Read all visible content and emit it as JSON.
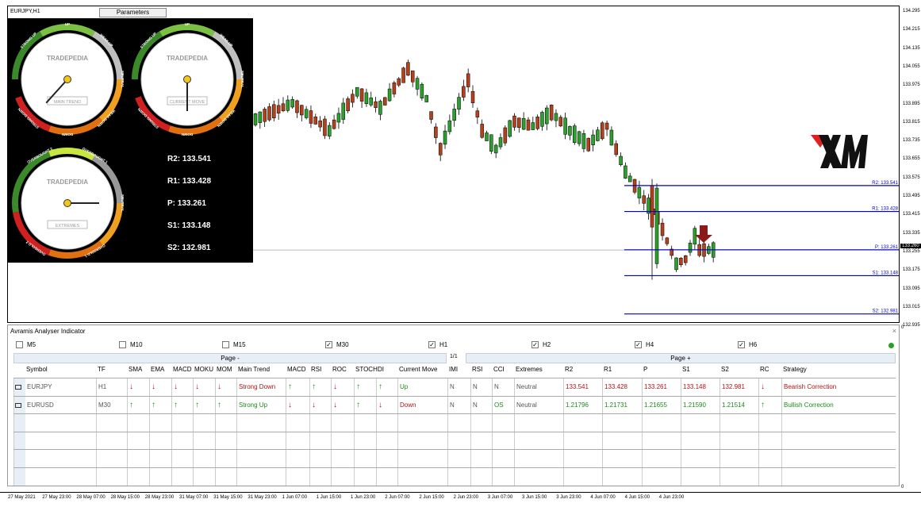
{
  "chart": {
    "symbol": "EURJPY,H1",
    "params_label": "Parameters",
    "price_ticks": [
      "134.295",
      "134.215",
      "134.135",
      "134.055",
      "133.975",
      "133.895",
      "133.815",
      "133.735",
      "133.655",
      "133.575",
      "133.495",
      "133.415",
      "133.335",
      "133.255",
      "133.175",
      "133.095",
      "133.015",
      "132.935"
    ],
    "current_price": "133.260",
    "zero_label": "0",
    "levels": [
      {
        "name": "R2",
        "label": "R2: 133.541",
        "value": 133.541
      },
      {
        "name": "R1",
        "label": "R1: 133.428",
        "value": 133.428
      },
      {
        "name": "P",
        "label": "P: 133.261",
        "value": 133.261
      },
      {
        "name": "S1",
        "label": "S1: 133.148",
        "value": 133.148
      },
      {
        "name": "S2",
        "label": "S2: 132.981",
        "value": 132.981
      }
    ],
    "time_ticks": [
      "27 May 2021",
      "27 May 23:00",
      "28 May 07:00",
      "28 May 15:00",
      "28 May 23:00",
      "31 May 07:00",
      "31 May 15:00",
      "31 May 23:00",
      "1 Jun 07:00",
      "1 Jun 15:00",
      "1 Jun 23:00",
      "2 Jun 07:00",
      "2 Jun 15:00",
      "2 Jun 23:00",
      "3 Jun 07:00",
      "3 Jun 15:00",
      "3 Jun 23:00",
      "4 Jun 07:00",
      "4 Jun 15:00",
      "4 Jun 23:00"
    ],
    "bull_color": "#2ca02c",
    "bear_color": "#b5401c",
    "level_color": "#0000cc"
  },
  "gauges": {
    "brand": "TRADEPEDIA",
    "g1": {
      "caption": "MAIN TREND",
      "labels": [
        "UP",
        "WEAK UP",
        "NEUTRAL",
        "WEAK DOWN",
        "DOWN",
        "STRONG DOWN",
        "STRONG UP"
      ]
    },
    "g2": {
      "caption": "CURRENT MOVE",
      "labels": [
        "UP",
        "WEAK UP",
        "NEUTRAL",
        "WEAK DOWN",
        "DOWN",
        "STRONG DOWN",
        "STRONG UP"
      ]
    },
    "g3": {
      "caption": "EXTREMES",
      "labels": [
        "OVERBOUGHT 1",
        "NEUTRAL",
        "OVERSOLD 1",
        "OVERSOLD 2",
        "OVERBOUGHT 2"
      ]
    }
  },
  "pivots": {
    "r2": "R2: 133.541",
    "r1": "R1: 133.428",
    "p": "P:  133.261",
    "s1": "S1: 133.148",
    "s2": "S2: 132.981"
  },
  "logo_text": "XM",
  "indicator": {
    "title": "Avramis Analyser Indicator",
    "close": "×",
    "timeframes": [
      {
        "label": "M5",
        "checked": false
      },
      {
        "label": "M10",
        "checked": false
      },
      {
        "label": "M15",
        "checked": false
      },
      {
        "label": "M30",
        "checked": true
      },
      {
        "label": "H1",
        "checked": true
      },
      {
        "label": "H2",
        "checked": true
      },
      {
        "label": "H4",
        "checked": true
      },
      {
        "label": "H6",
        "checked": true
      }
    ],
    "page_prev": "Page -",
    "page_next": "Page +",
    "page_count": "1/1",
    "headers": [
      "Symbol",
      "TF",
      "SMA",
      "EMA",
      "MACD",
      "MOKU",
      "MOM",
      "Main Trend",
      "MACD",
      "RSI",
      "ROC",
      "STOCH",
      "DI",
      "Current Move",
      "IMI",
      "RSI",
      "CCI",
      "Extremes",
      "R2",
      "R1",
      "P",
      "S1",
      "S2",
      "RC",
      "Strategy"
    ],
    "rows": [
      {
        "symbol": "EURJPY",
        "tf": "H1",
        "sma": "↓",
        "ema": "↓",
        "macd": "↓",
        "moku": "↓",
        "mom": "↓",
        "main_trend": "Strong Down",
        "macd2": "↑",
        "rsi": "↑",
        "roc": "↓",
        "stoch": "↑",
        "di": "↑",
        "current_move": "Up",
        "imi": "N",
        "rsi2": "N",
        "cci": "N",
        "extremes": "Neutral",
        "r2": "133.541",
        "r1": "133.428",
        "p": "133.261",
        "s1": "133.148",
        "s2": "132.981",
        "rc": "↓",
        "strategy": "Bearish Correction"
      },
      {
        "symbol": "EURUSD",
        "tf": "M30",
        "sma": "↑",
        "ema": "↑",
        "macd": "↑",
        "moku": "↑",
        "mom": "↑",
        "main_trend": "Strong Up",
        "macd2": "↓",
        "rsi": "↓",
        "roc": "↓",
        "stoch": "↑",
        "di": "↓",
        "current_move": "Down",
        "imi": "N",
        "rsi2": "N",
        "cci": "OS",
        "extremes": "Neutral",
        "r2": "1.21796",
        "r1": "1.21731",
        "p": "1.21655",
        "s1": "1.21590",
        "s2": "1.21514",
        "rc": "↑",
        "strategy": "Bullish Correction"
      }
    ]
  }
}
